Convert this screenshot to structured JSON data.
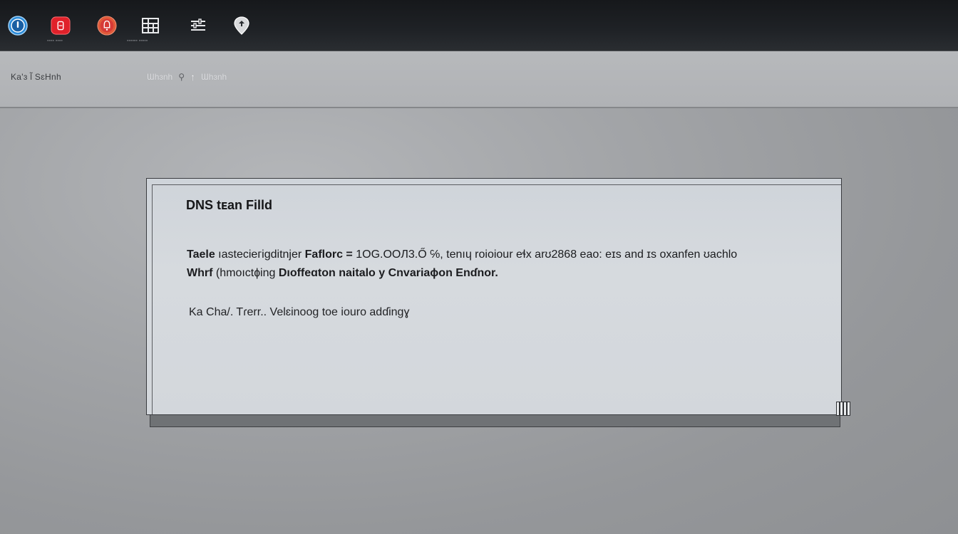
{
  "toolbar": {
    "icons": [
      {
        "name": "power-icon",
        "label": "",
        "color": "#2a8ad8"
      },
      {
        "name": "record-icon",
        "label": "",
        "color": "#e0212a"
      },
      {
        "name": "alert-icon",
        "label": "",
        "color": "#d63a36"
      },
      {
        "name": "grid-icon",
        "label": ""
      },
      {
        "name": "sliders-icon",
        "label": ""
      },
      {
        "name": "pin-icon",
        "label": ""
      }
    ]
  },
  "subbar": {
    "breadcrumb": "Ka'ɜ l̃ SɛHnh",
    "search_ghost": "Ɯhɜnh",
    "search_trailing": "Ɯhɜnh"
  },
  "dialog": {
    "title": "DNS tᴇan Filld",
    "line1_bold_a": "Taele",
    "line1_rest": " ıastecieгigditnjer ",
    "line1_bold_b": "Faflorc =",
    "line1_tail": " 1OG.OOЛ3.Ő ℅,  tenıɥ roioiour  eɬx  arʊ2868 eao: eɪs  and  ɪs  oxanfen  ʊachlo",
    "line2_bold_a": "Whrf",
    "line2_rest": " (hmoıctɸing ",
    "line2_bold_b": "Dıoffeɑton naitalo  y  Cnvariaɸon Enɗnor.",
    "line3": "Ka  Cha/.  Tɾerr..  Velɛinoog  toe  iouro adɗingɣ"
  },
  "colors": {
    "topbar": "#1f2226",
    "subbar": "#b4b6b9",
    "dialog": "#d3d7dc",
    "accent_blue": "#2a8ad8",
    "accent_red": "#e0212a"
  }
}
